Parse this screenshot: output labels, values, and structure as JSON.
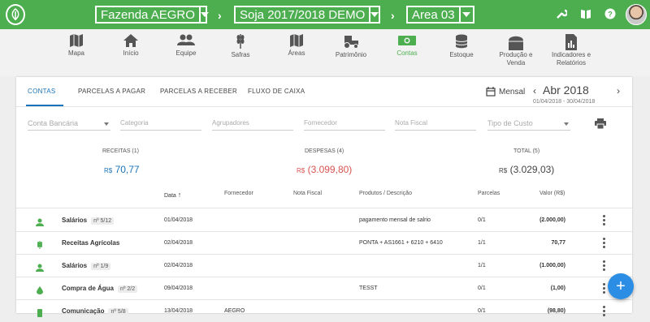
{
  "topbar": {
    "farm": "Fazenda AEGRO",
    "season": "Soja 2017/2018 DEMO",
    "area": "Area 03"
  },
  "nav": [
    {
      "label": "Mapa",
      "icon": "map-icon"
    },
    {
      "label": "Início",
      "icon": "home-icon"
    },
    {
      "label": "Equipe",
      "icon": "people-icon"
    },
    {
      "label": "Safras",
      "icon": "wheat-icon"
    },
    {
      "label": "Áreas",
      "icon": "map-icon"
    },
    {
      "label": "Patrimônio",
      "icon": "tractor-icon"
    },
    {
      "label": "Contas",
      "icon": "money-icon"
    },
    {
      "label": "Estoque",
      "icon": "database-icon"
    },
    {
      "label": "Produção e",
      "label2": "Venda",
      "icon": "silo-icon"
    },
    {
      "label": "Indicadores e",
      "label2": "Relatórios",
      "icon": "report-icon"
    }
  ],
  "tabs": [
    "CONTAS",
    "PARCELAS A PAGAR",
    "PARCELAS A RECEBER",
    "FLUXO DE CAIXA"
  ],
  "period": {
    "mode": "Mensal",
    "month": "Abr 2018",
    "range": "01/04/2018 - 30/04/2018"
  },
  "filters": {
    "conta": "Conta Bancária",
    "categoria": "Categoria",
    "agrupadores": "Agrupadores",
    "fornecedor": "Fornecedor",
    "nota": "Nota Fiscal",
    "tipo": "Tipo de Custo"
  },
  "summary": {
    "receitas_label": "RECEITAS (1)",
    "receitas_currency": "R$",
    "receitas_value": "70,77",
    "despesas_label": "DESPESAS (4)",
    "despesas_currency": "R$",
    "despesas_value": "(3.099,80)",
    "total_label": "TOTAL (5)",
    "total_currency": "R$",
    "total_value": "(3.029,03)"
  },
  "columns": {
    "data": "Data",
    "fornecedor": "Fornecedor",
    "nota": "Nota Fiscal",
    "produtos": "Produtos / Descrição",
    "parcelas": "Parcelas",
    "valor": "Valor (R$)"
  },
  "rows": [
    {
      "name": "Salários",
      "badge": "nº 5/12",
      "date": "01/04/2018",
      "fornecedor": "",
      "produtos": "pagamento mensal de salrio",
      "parcelas": "0/1",
      "valor": "(2.000,00)",
      "icon": "person-icon"
    },
    {
      "name": "Receitas Agrícolas",
      "badge": "",
      "date": "02/04/2018",
      "fornecedor": "",
      "produtos": "PONTA + AS1661 + 6210 + 6410",
      "parcelas": "1/1",
      "valor": "70,77",
      "icon": "wheat-icon"
    },
    {
      "name": "Salários",
      "badge": "nº 1/9",
      "date": "02/04/2018",
      "fornecedor": "",
      "produtos": "",
      "parcelas": "1/1",
      "valor": "(1.000,00)",
      "icon": "person-icon"
    },
    {
      "name": "Compra de Água",
      "badge": "nº 2/2",
      "date": "09/04/2018",
      "fornecedor": "",
      "produtos": "TESST",
      "parcelas": "0/1",
      "valor": "(1,00)",
      "icon": "drop-icon"
    },
    {
      "name": "Comunicação",
      "badge": "nº 5/8",
      "date": "13/04/2018",
      "fornecedor": "AEGRO",
      "produtos": "",
      "parcelas": "0/1",
      "valor": "(98,80)",
      "icon": "phone-icon"
    }
  ],
  "fab": "+",
  "colors": {
    "brand": "#4cae4f",
    "positive": "#1a73b8",
    "negative": "#d9534f",
    "fab": "#2b8ee4"
  }
}
